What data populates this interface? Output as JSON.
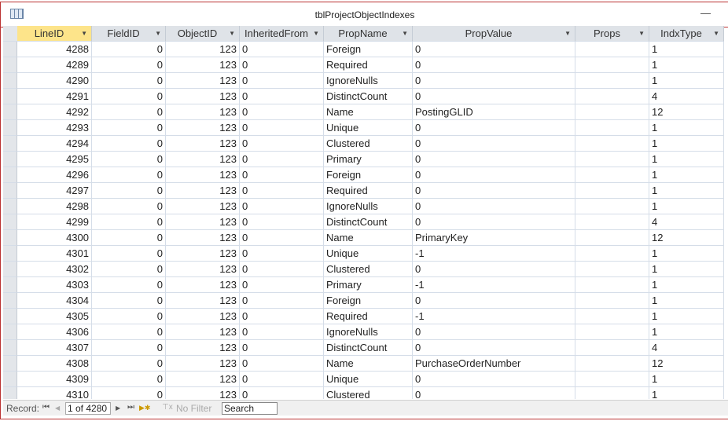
{
  "window": {
    "title": "tblProjectObjectIndexes",
    "minimize": "—"
  },
  "columns": [
    {
      "label": "LineID",
      "dd": "▼"
    },
    {
      "label": "FieldID",
      "dd": "▼"
    },
    {
      "label": "ObjectID",
      "dd": "▼"
    },
    {
      "label": "InheritedFrom",
      "dd": "▼"
    },
    {
      "label": "PropName",
      "dd": "▼"
    },
    {
      "label": "PropValue",
      "dd": "▼"
    },
    {
      "label": "Props",
      "dd": "▼"
    },
    {
      "label": "IndxType",
      "dd": "▼"
    }
  ],
  "rows": [
    [
      "4288",
      "0",
      "123",
      "0",
      "Foreign",
      "0",
      "",
      "1"
    ],
    [
      "4289",
      "0",
      "123",
      "0",
      "Required",
      "0",
      "",
      "1"
    ],
    [
      "4290",
      "0",
      "123",
      "0",
      "IgnoreNulls",
      "0",
      "",
      "1"
    ],
    [
      "4291",
      "0",
      "123",
      "0",
      "DistinctCount",
      "0",
      "",
      "4"
    ],
    [
      "4292",
      "0",
      "123",
      "0",
      "Name",
      "PostingGLID",
      "",
      "12"
    ],
    [
      "4293",
      "0",
      "123",
      "0",
      "Unique",
      "0",
      "",
      "1"
    ],
    [
      "4294",
      "0",
      "123",
      "0",
      "Clustered",
      "0",
      "",
      "1"
    ],
    [
      "4295",
      "0",
      "123",
      "0",
      "Primary",
      "0",
      "",
      "1"
    ],
    [
      "4296",
      "0",
      "123",
      "0",
      "Foreign",
      "0",
      "",
      "1"
    ],
    [
      "4297",
      "0",
      "123",
      "0",
      "Required",
      "0",
      "",
      "1"
    ],
    [
      "4298",
      "0",
      "123",
      "0",
      "IgnoreNulls",
      "0",
      "",
      "1"
    ],
    [
      "4299",
      "0",
      "123",
      "0",
      "DistinctCount",
      "0",
      "",
      "4"
    ],
    [
      "4300",
      "0",
      "123",
      "0",
      "Name",
      "PrimaryKey",
      "",
      "12"
    ],
    [
      "4301",
      "0",
      "123",
      "0",
      "Unique",
      "-1",
      "",
      "1"
    ],
    [
      "4302",
      "0",
      "123",
      "0",
      "Clustered",
      "0",
      "",
      "1"
    ],
    [
      "4303",
      "0",
      "123",
      "0",
      "Primary",
      "-1",
      "",
      "1"
    ],
    [
      "4304",
      "0",
      "123",
      "0",
      "Foreign",
      "0",
      "",
      "1"
    ],
    [
      "4305",
      "0",
      "123",
      "0",
      "Required",
      "-1",
      "",
      "1"
    ],
    [
      "4306",
      "0",
      "123",
      "0",
      "IgnoreNulls",
      "0",
      "",
      "1"
    ],
    [
      "4307",
      "0",
      "123",
      "0",
      "DistinctCount",
      "0",
      "",
      "4"
    ],
    [
      "4308",
      "0",
      "123",
      "0",
      "Name",
      "PurchaseOrderNumber",
      "",
      "12"
    ],
    [
      "4309",
      "0",
      "123",
      "0",
      "Unique",
      "0",
      "",
      "1"
    ],
    [
      "4310",
      "0",
      "123",
      "0",
      "Clustered",
      "0",
      "",
      "1"
    ]
  ],
  "nav": {
    "label": "Record:",
    "first": "⏮",
    "prev": "◀",
    "record": "1 of 4280",
    "next": "▶",
    "last": "⏭",
    "new": "▶✱",
    "filter_icon": "⊤x",
    "filter": "No Filter",
    "search": "Search"
  }
}
